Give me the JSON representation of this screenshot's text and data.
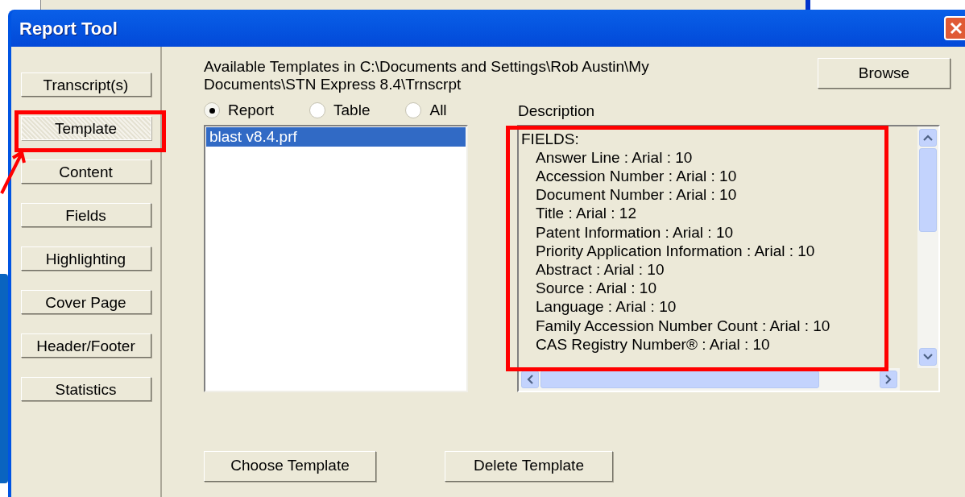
{
  "window": {
    "title": "Report Tool"
  },
  "sidebar": {
    "items": [
      {
        "label": "Transcript(s)",
        "selected": false
      },
      {
        "label": "Template",
        "selected": true
      },
      {
        "label": "Content",
        "selected": false
      },
      {
        "label": "Fields",
        "selected": false
      },
      {
        "label": "Highlighting",
        "selected": false
      },
      {
        "label": "Cover Page",
        "selected": false
      },
      {
        "label": "Header/Footer",
        "selected": false
      },
      {
        "label": "Statistics",
        "selected": false
      }
    ]
  },
  "path_label": "Available Templates in C:\\Documents and Settings\\Rob Austin\\My Documents\\STN Express 8.4\\Trnscrpt",
  "browse_button": "Browse",
  "filter": [
    {
      "label": "Report",
      "selected": true
    },
    {
      "label": "Table",
      "selected": false
    },
    {
      "label": "All",
      "selected": false
    }
  ],
  "templates": [
    {
      "name": "blast v8.4.prf",
      "selected": true
    }
  ],
  "description": {
    "label": "Description",
    "heading": "FIELDS:",
    "lines": [
      "Answer Line : Arial : 10",
      "Accession Number : Arial : 10",
      "Document Number : Arial : 10",
      "Title : Arial : 12",
      "Patent Information : Arial : 10",
      "Priority Application Information : Arial : 10",
      "Abstract : Arial : 10",
      "Source : Arial : 10",
      "Language : Arial : 10",
      "Family Accession Number Count : Arial : 10",
      "CAS Registry Number® : Arial : 10"
    ]
  },
  "buttons": [
    "Choose Template",
    "Delete Template"
  ]
}
